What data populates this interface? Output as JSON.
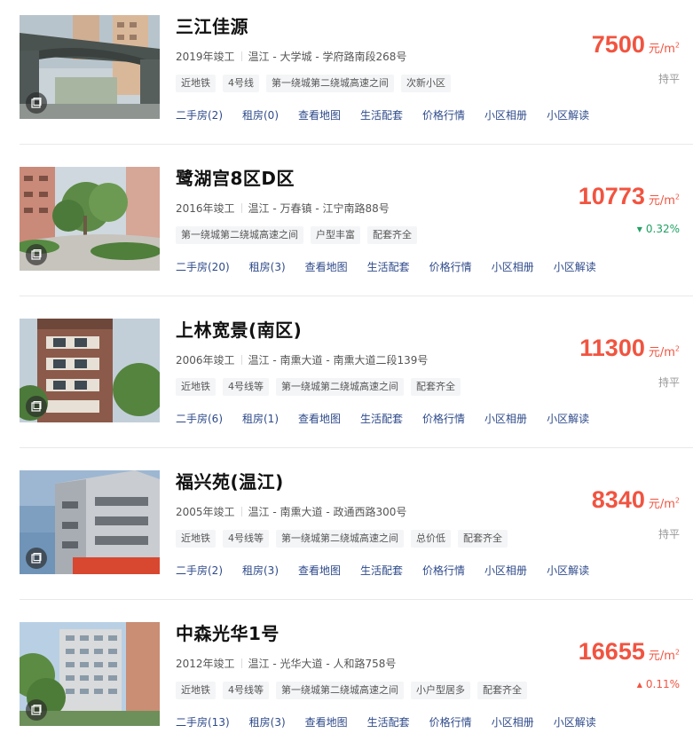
{
  "listings": [
    {
      "name": "三江佳源",
      "year": "2019年竣工",
      "location": "温江 - 大学城 - 学府路南段268号",
      "tags": [
        "近地铁",
        "4号线",
        "第一绕城第二绕城高速之间",
        "次新小区"
      ],
      "links": [
        "二手房(2)",
        "租房(0)",
        "查看地图",
        "生活配套",
        "价格行情",
        "小区相册",
        "小区解读"
      ],
      "price": "7500",
      "unit": "元/m",
      "change": "持平",
      "change_dir": "flat",
      "photo_icon": "album-icon"
    },
    {
      "name": "鹭湖宫8区D区",
      "year": "2016年竣工",
      "location": "温江 - 万春镇 - 江宁南路88号",
      "tags": [
        "第一绕城第二绕城高速之间",
        "户型丰富",
        "配套齐全"
      ],
      "links": [
        "二手房(20)",
        "租房(3)",
        "查看地图",
        "生活配套",
        "价格行情",
        "小区相册",
        "小区解读"
      ],
      "price": "10773",
      "unit": "元/m",
      "change": "0.32%",
      "change_dir": "down",
      "photo_icon": "album-icon"
    },
    {
      "name": "上林宽景(南区)",
      "year": "2006年竣工",
      "location": "温江 - 南熏大道 - 南熏大道二段139号",
      "tags": [
        "近地铁",
        "4号线等",
        "第一绕城第二绕城高速之间",
        "配套齐全"
      ],
      "links": [
        "二手房(6)",
        "租房(1)",
        "查看地图",
        "生活配套",
        "价格行情",
        "小区相册",
        "小区解读"
      ],
      "price": "11300",
      "unit": "元/m",
      "change": "持平",
      "change_dir": "flat",
      "photo_icon": "album-icon"
    },
    {
      "name": "福兴苑(温江)",
      "year": "2005年竣工",
      "location": "温江 - 南熏大道 - 政通西路300号",
      "tags": [
        "近地铁",
        "4号线等",
        "第一绕城第二绕城高速之间",
        "总价低",
        "配套齐全"
      ],
      "links": [
        "二手房(2)",
        "租房(3)",
        "查看地图",
        "生活配套",
        "价格行情",
        "小区相册",
        "小区解读"
      ],
      "price": "8340",
      "unit": "元/m",
      "change": "持平",
      "change_dir": "flat",
      "photo_icon": "album-icon"
    },
    {
      "name": "中森光华1号",
      "year": "2012年竣工",
      "location": "温江 - 光华大道 - 人和路758号",
      "tags": [
        "近地铁",
        "4号线等",
        "第一绕城第二绕城高速之间",
        "小户型居多",
        "配套齐全"
      ],
      "links": [
        "二手房(13)",
        "租房(3)",
        "查看地图",
        "生活配套",
        "价格行情",
        "小区相册",
        "小区解读"
      ],
      "price": "16655",
      "unit": "元/m",
      "change": "0.11%",
      "change_dir": "up",
      "photo_icon": "album-icon"
    }
  ],
  "colors": {
    "price": "#f15440",
    "link": "#2e4a8a",
    "down": "#20a162",
    "flat": "#999999"
  }
}
